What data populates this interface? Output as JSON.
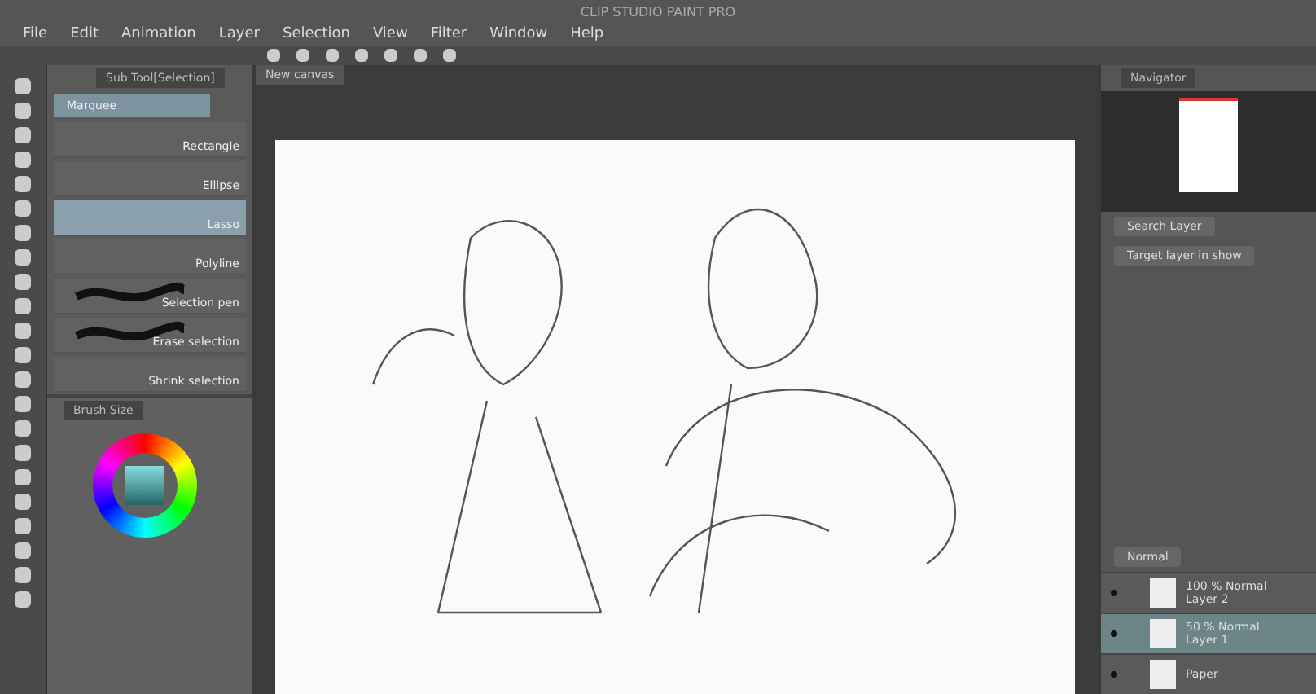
{
  "window": {
    "title": "CLIP STUDIO PAINT PRO"
  },
  "menu": [
    "File",
    "Edit",
    "Animation",
    "Layer",
    "Selection",
    "View",
    "Filter",
    "Window",
    "Help"
  ],
  "canvas_tab": {
    "label": "New canvas"
  },
  "sub_tool": {
    "tab": "Sub Tool[Selection]",
    "group": "Marquee",
    "items": [
      {
        "label": "Rectangle",
        "selected": false,
        "kind": "plain"
      },
      {
        "label": "Ellipse",
        "selected": false,
        "kind": "plain"
      },
      {
        "label": "Lasso",
        "selected": true,
        "kind": "plain"
      },
      {
        "label": "Polyline",
        "selected": false,
        "kind": "plain"
      },
      {
        "label": "Selection pen",
        "selected": false,
        "kind": "stroke"
      },
      {
        "label": "Erase selection",
        "selected": false,
        "kind": "stroke"
      },
      {
        "label": "Shrink selection",
        "selected": false,
        "kind": "plain"
      }
    ]
  },
  "brush_size": {
    "tab": "Brush Size"
  },
  "navigator": {
    "tab": "Navigator"
  },
  "layer_search": {
    "button": "Search Layer",
    "filter": "Target layer in show"
  },
  "layers": {
    "blend_mode": "Normal",
    "items": [
      {
        "mode": "100 % Normal",
        "name": "Layer 2",
        "selected": false,
        "visible": true
      },
      {
        "mode": "50 % Normal",
        "name": "Layer 1",
        "selected": true,
        "visible": true
      },
      {
        "name": "Paper",
        "selected": false,
        "visible": true
      }
    ]
  }
}
